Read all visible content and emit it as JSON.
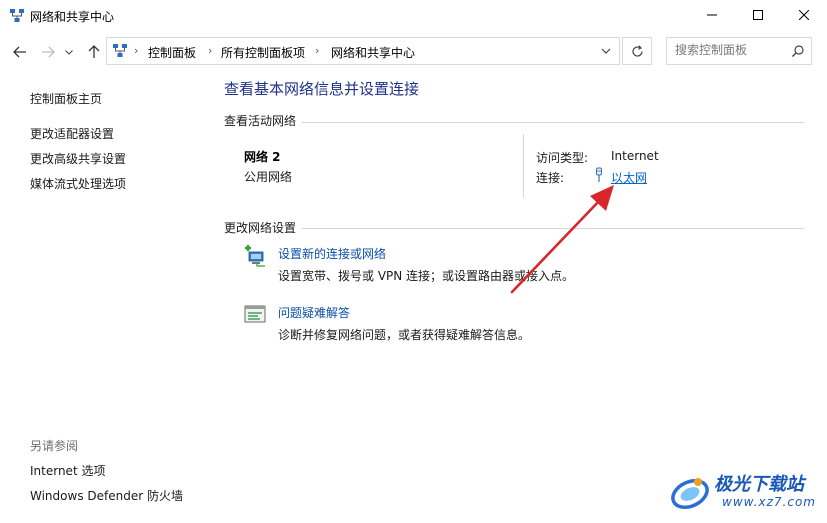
{
  "window": {
    "title": "网络和共享中心",
    "icon": "network-sharing-icon"
  },
  "navigation": {
    "breadcrumbs": [
      "控制面板",
      "所有控制面板项",
      "网络和共享中心"
    ],
    "search_placeholder": "搜索控制面板"
  },
  "sidebar": {
    "home_link": "控制面板主页",
    "links": [
      "更改适配器设置",
      "更改高级共享设置",
      "媒体流式处理选项"
    ],
    "see_also_label": "另请参阅",
    "see_also_links": [
      "Internet 选项",
      "Windows Defender 防火墙"
    ]
  },
  "main": {
    "title": "查看基本网络信息并设置连接",
    "active_networks_heading": "查看活动网络",
    "network": {
      "name": "网络 2",
      "category": "公用网络",
      "access_type_label": "访问类型:",
      "access_type_value": "Internet",
      "connection_label": "连接:",
      "connection_value": "以太网"
    },
    "change_settings_heading": "更改网络设置",
    "tasks": [
      {
        "icon": "new-connection-icon",
        "link": "设置新的连接或网络",
        "description": "设置宽带、拨号或 VPN 连接；或设置路由器或接入点。"
      },
      {
        "icon": "troubleshoot-icon",
        "link": "问题疑难解答",
        "description": "诊断并修复网络问题，或者获得疑难解答信息。"
      }
    ]
  },
  "annotation": {
    "arrow_color": "#d9262b"
  },
  "watermark": {
    "brand": "极光下载站",
    "url": "www.xz7.com"
  }
}
